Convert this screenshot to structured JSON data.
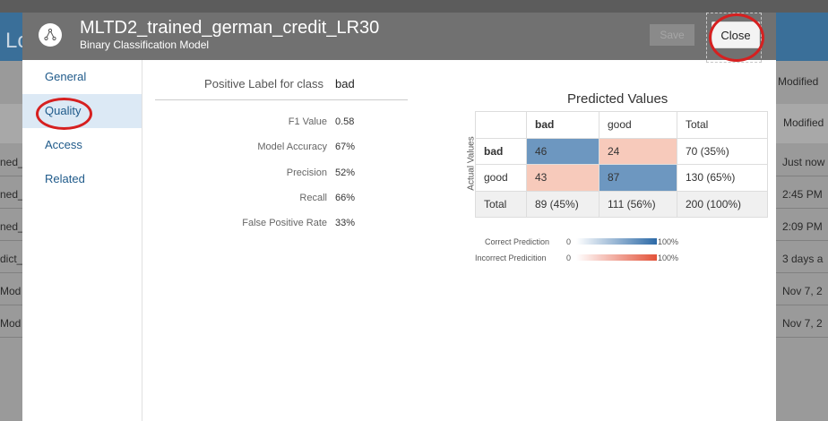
{
  "background": {
    "left_rows": [
      "ned_",
      "ned_",
      "ned_",
      "dict_",
      "Mod",
      "Mod"
    ],
    "right_header": "Modified",
    "right_dropdown": "Modified",
    "right_rows": [
      "Just now",
      "2:45 PM",
      "2:09 PM",
      "3 days a",
      "Nov 7, 2",
      "Nov 7, 2"
    ],
    "app_prefix": "Lo"
  },
  "modal": {
    "title": "MLTD2_trained_german_credit_LR30",
    "subtitle": "Binary Classification Model",
    "save_label": "Save",
    "close_label": "Close"
  },
  "nav": {
    "items": [
      {
        "label": "General"
      },
      {
        "label": "Quality"
      },
      {
        "label": "Access"
      },
      {
        "label": "Related"
      }
    ]
  },
  "metrics": {
    "positive_label_title": "Positive Label for class",
    "positive_label_value": "bad",
    "rows": [
      {
        "label": "F1 Value",
        "value": "0.58"
      },
      {
        "label": "Model Accuracy",
        "value": "67%"
      },
      {
        "label": "Precision",
        "value": "52%"
      },
      {
        "label": "Recall",
        "value": "66%"
      },
      {
        "label": "False Positive Rate",
        "value": "33%"
      }
    ]
  },
  "predicted": {
    "title": "Predicted Values",
    "y_axis_label": "Actual Values",
    "columns": [
      "bad",
      "good",
      "Total"
    ],
    "rows": [
      {
        "label": "bad",
        "cells": [
          "46",
          "24",
          "70 (35%)"
        ]
      },
      {
        "label": "good",
        "cells": [
          "43",
          "87",
          "130 (65%)"
        ]
      },
      {
        "label": "Total",
        "cells": [
          "89 (45%)",
          "111 (56%)",
          "200 (100%)"
        ]
      }
    ],
    "legend": {
      "correct_label": "Correct Prediction",
      "incorrect_label": "Incorrect Predicition",
      "min": "0",
      "max": "100%"
    }
  }
}
